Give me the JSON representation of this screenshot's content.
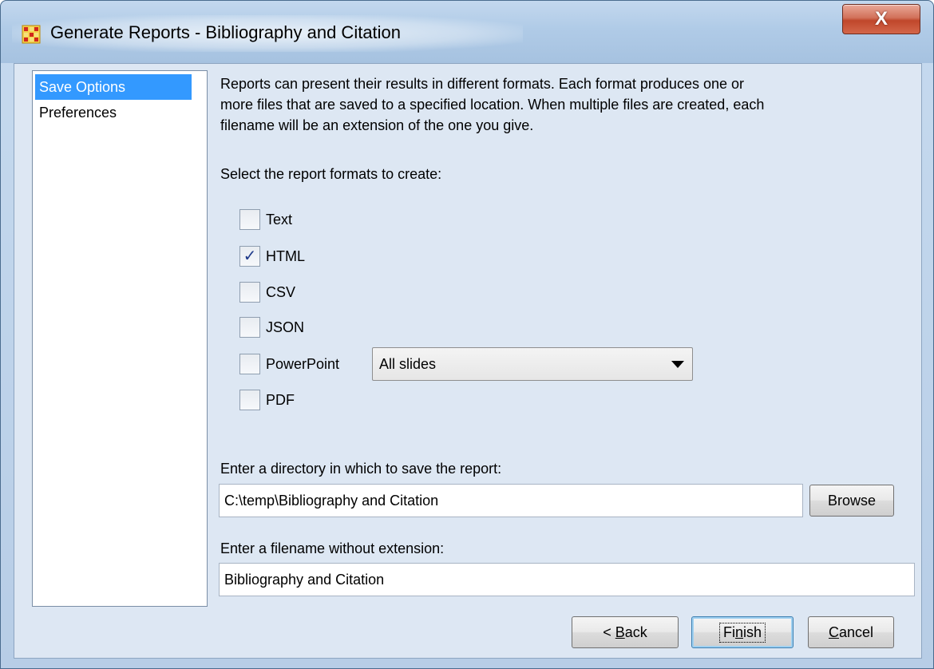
{
  "window": {
    "title": "Generate Reports - Bibliography and Citation",
    "close_label": "X"
  },
  "sidebar": {
    "items": [
      {
        "label": "Save Options",
        "selected": true
      },
      {
        "label": "Preferences",
        "selected": false
      }
    ]
  },
  "main": {
    "description_lines": [
      "Reports can present their results in different formats. Each format produces one or",
      "more files that are saved to a specified location. When multiple files are created, each",
      "filename will be an extension of the one you give."
    ],
    "select_label": "Select the report formats to create:",
    "formats": [
      {
        "label": "Text",
        "checked": false
      },
      {
        "label": "HTML",
        "checked": true
      },
      {
        "label": "CSV",
        "checked": false
      },
      {
        "label": "JSON",
        "checked": false
      },
      {
        "label": "PowerPoint",
        "checked": false
      },
      {
        "label": "PDF",
        "checked": false
      }
    ],
    "powerpoint_option": "All slides",
    "directory_label": "Enter a directory in which to save the report:",
    "directory_value": "C:\\temp\\Bibliography and Citation",
    "browse_label": "Browse",
    "filename_label": "Enter a filename without extension:",
    "filename_value": "Bibliography and Citation"
  },
  "footer": {
    "back_prefix": "< ",
    "back_mnemonic": "B",
    "back_rest": "ack",
    "finish_prefix": "Fi",
    "finish_mnemonic": "n",
    "finish_rest": "ish",
    "cancel_mnemonic": "C",
    "cancel_rest": "ancel"
  },
  "colors": {
    "selection": "#3399ff",
    "check": "#1f3a8a",
    "close_button": "#c0472b"
  }
}
